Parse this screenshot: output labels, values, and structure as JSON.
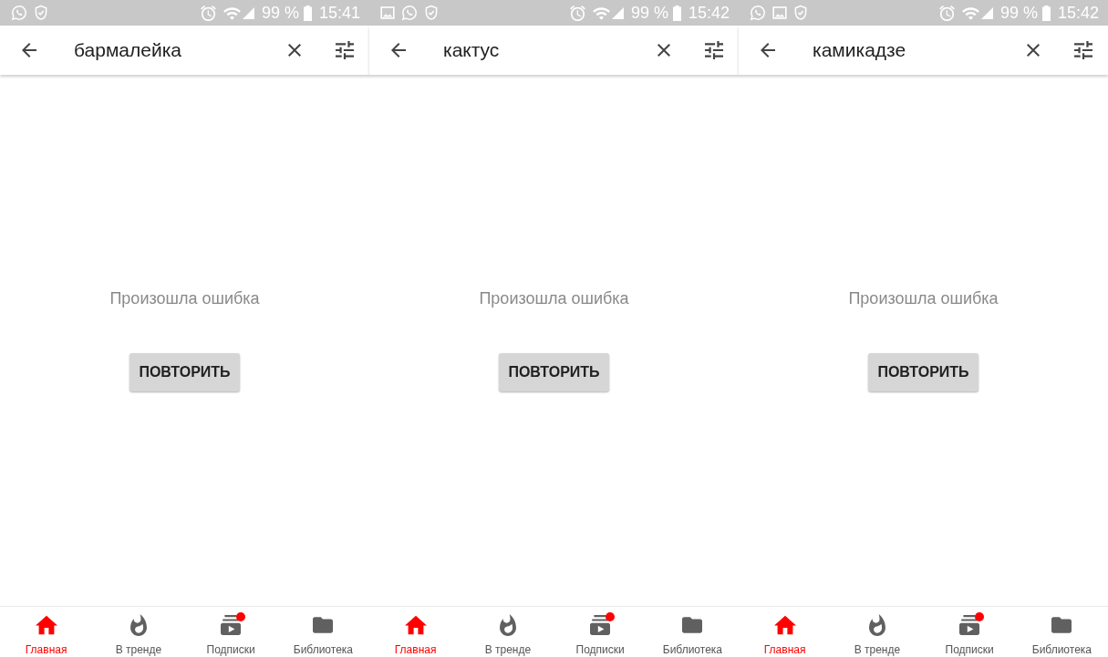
{
  "screens": [
    {
      "status_bar": {
        "notification_icons": [
          {
            "kind": "whatsapp"
          },
          {
            "kind": "shield"
          }
        ],
        "battery": "99 %",
        "time": "15:41"
      },
      "search_bar": {
        "query": "бармалейка"
      },
      "error": {
        "message": "Произошла ошибка",
        "retry_button": "ПОВТОРИТЬ"
      },
      "bottom_nav": [
        {
          "kind": "home",
          "label": "Главная",
          "selected": true,
          "badge": false
        },
        {
          "kind": "trending",
          "label": "В тренде",
          "selected": false,
          "badge": false
        },
        {
          "kind": "subscriptions",
          "label": "Подписки",
          "selected": false,
          "badge": true
        },
        {
          "kind": "library",
          "label": "Библиотека",
          "selected": false,
          "badge": false
        }
      ]
    },
    {
      "status_bar": {
        "notification_icons": [
          {
            "kind": "image"
          },
          {
            "kind": "whatsapp"
          },
          {
            "kind": "shield"
          }
        ],
        "battery": "99 %",
        "time": "15:42"
      },
      "search_bar": {
        "query": "кактус"
      },
      "error": {
        "message": "Произошла ошибка",
        "retry_button": "ПОВТОРИТЬ"
      },
      "bottom_nav": [
        {
          "kind": "home",
          "label": "Главная",
          "selected": true,
          "badge": false
        },
        {
          "kind": "trending",
          "label": "В тренде",
          "selected": false,
          "badge": false
        },
        {
          "kind": "subscriptions",
          "label": "Подписки",
          "selected": false,
          "badge": true
        },
        {
          "kind": "library",
          "label": "Библиотека",
          "selected": false,
          "badge": false
        }
      ]
    },
    {
      "status_bar": {
        "notification_icons": [
          {
            "kind": "whatsapp"
          },
          {
            "kind": "image"
          },
          {
            "kind": "shield"
          }
        ],
        "battery": "99 %",
        "time": "15:42"
      },
      "search_bar": {
        "query": "камикадзе"
      },
      "error": {
        "message": "Произошла ошибка",
        "retry_button": "ПОВТОРИТЬ"
      },
      "bottom_nav": [
        {
          "kind": "home",
          "label": "Главная",
          "selected": true,
          "badge": false
        },
        {
          "kind": "trending",
          "label": "В тренде",
          "selected": false,
          "badge": false
        },
        {
          "kind": "subscriptions",
          "label": "Подписки",
          "selected": false,
          "badge": true
        },
        {
          "kind": "library",
          "label": "Библиотека",
          "selected": false,
          "badge": false
        }
      ]
    }
  ]
}
